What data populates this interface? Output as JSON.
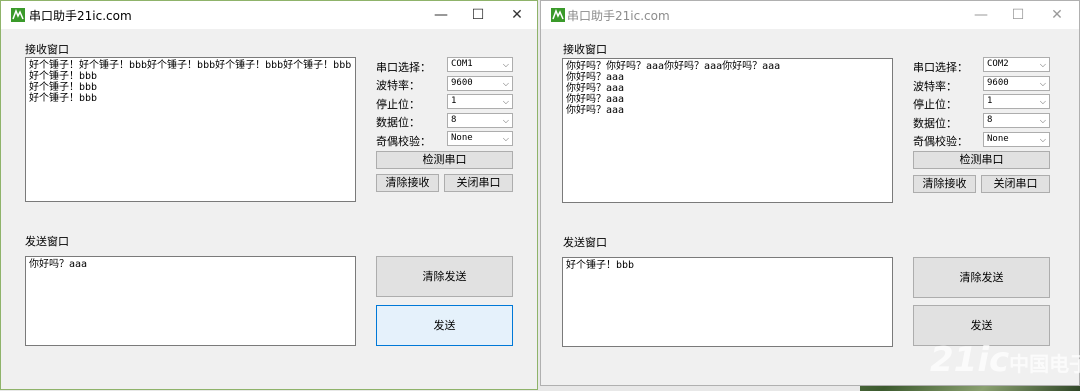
{
  "windows": [
    {
      "title": "串口助手21ic.com",
      "recv_label": "接收窗口",
      "recv_lines": [
        "好个锤子！好个锤子！bbb好个锤子！bbb好个锤子！bbb好个锤子！bbb",
        "好个锤子！bbb",
        "好个锤子！bbb",
        "好个锤子！bbb"
      ],
      "send_label": "发送窗口",
      "send_text": "你好吗？aaa",
      "port_label": "串口选择：",
      "port_value": "COM1",
      "baud_label": "波特率：",
      "baud_value": "9600",
      "stop_label": "停止位：",
      "stop_value": "1",
      "data_label": "数据位：",
      "data_value": "8",
      "parity_label": "奇偶校验：",
      "parity_value": "None",
      "detect_btn": "检测串口",
      "clear_recv_btn": "清除接收",
      "close_port_btn": "关闭串口",
      "clear_send_btn": "清除发送",
      "send_btn": "发送"
    },
    {
      "title": "串口助手21ic.com",
      "recv_label": "接收窗口",
      "recv_lines": [
        "你好吗？你好吗？aaa你好吗？aaa你好吗？aaa",
        "你好吗？aaa",
        "你好吗？aaa",
        "你好吗？aaa",
        "你好吗？aaa"
      ],
      "send_label": "发送窗口",
      "send_text": "好个锤子！bbb",
      "port_label": "串口选择：",
      "port_value": "COM2",
      "baud_label": "波特率：",
      "baud_value": "9600",
      "stop_label": "停止位：",
      "stop_value": "1",
      "data_label": "数据位：",
      "data_value": "8",
      "parity_label": "奇偶校验：",
      "parity_value": "None",
      "detect_btn": "检测串口",
      "clear_recv_btn": "清除接收",
      "close_port_btn": "关闭串口",
      "clear_send_btn": "清除发送",
      "send_btn": "发送"
    }
  ],
  "window_controls": {
    "minimize": "—",
    "maximize": "☐",
    "close": "✕"
  },
  "watermark": {
    "main": "21ic",
    "sub": "中国电子网"
  },
  "colors": {
    "app_icon_green": "#3a9a2a",
    "focus_blue": "#0078d7"
  }
}
